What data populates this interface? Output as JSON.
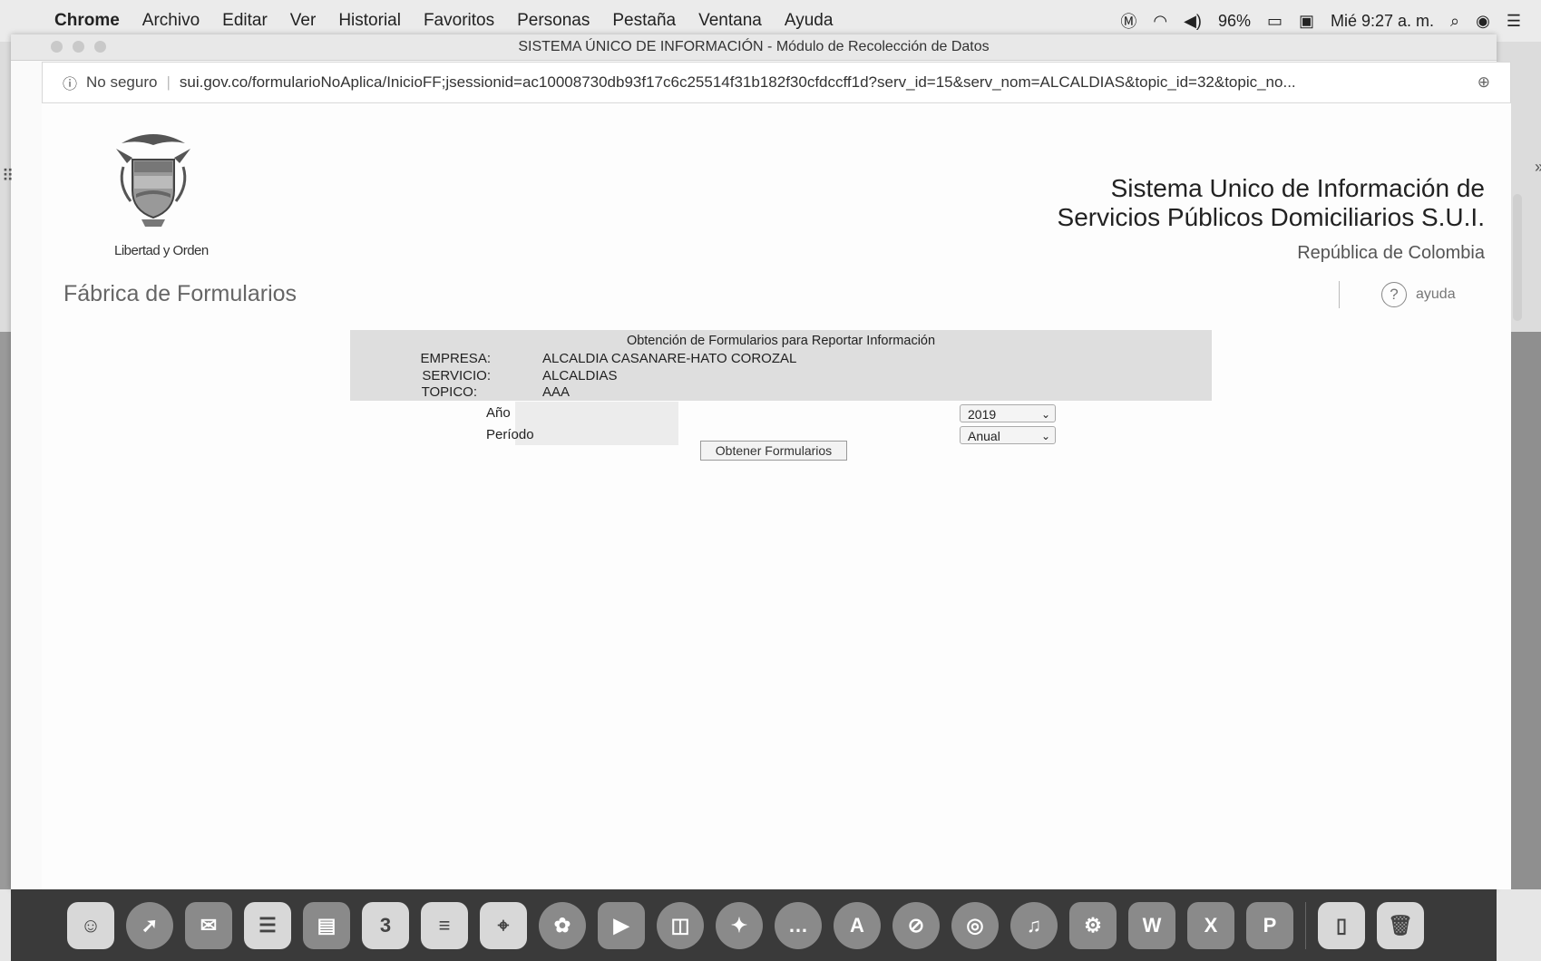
{
  "menubar": {
    "apple_icon": "apple-icon",
    "items": [
      "Chrome",
      "Archivo",
      "Editar",
      "Ver",
      "Historial",
      "Favoritos",
      "Personas",
      "Pestaña",
      "Ventana",
      "Ayuda"
    ],
    "battery": "96%",
    "clock": "Mié 9:27 a. m."
  },
  "window": {
    "title": "SISTEMA ÚNICO DE INFORMACIÓN - Módulo de Recolección de Datos"
  },
  "addressbar": {
    "security_label": "No seguro",
    "url": "sui.gov.co/formularioNoAplica/InicioFF;jsessionid=ac10008730db93f17c6c25514f31b182f30cfdccff1d?serv_id=15&serv_nom=ALCALDIAS&topic_id=32&topic_no..."
  },
  "header": {
    "motto": "Libertad y Orden",
    "section_title": "Fábrica de Formularios",
    "sui_line1": "Sistema Unico de Información de",
    "sui_line2": "Servicios Públicos Domiciliarios S.U.I.",
    "republica": "República de Colombia",
    "ayuda_label": "ayuda"
  },
  "form": {
    "title": "Obtención de Formularios para Reportar Información",
    "empresa_label": "EMPRESA:",
    "empresa_value": "ALCALDIA CASANARE-HATO COROZAL",
    "servicio_label": "SERVICIO:",
    "servicio_value": "ALCALDIAS",
    "topico_label": "TOPICO:",
    "topico_value": "AAA",
    "anio_label": "Año",
    "anio_value": "2019",
    "periodo_label": "Período",
    "periodo_value": "Anual",
    "submit_label": "Obtener Formularios"
  },
  "dock": {
    "calendar_day": "3",
    "word_letter": "W",
    "excel_letter": "X",
    "ppt_letter": "P"
  },
  "colors": {
    "form_header_bg": "#dedede",
    "page_bg": "#fdfdfd"
  }
}
